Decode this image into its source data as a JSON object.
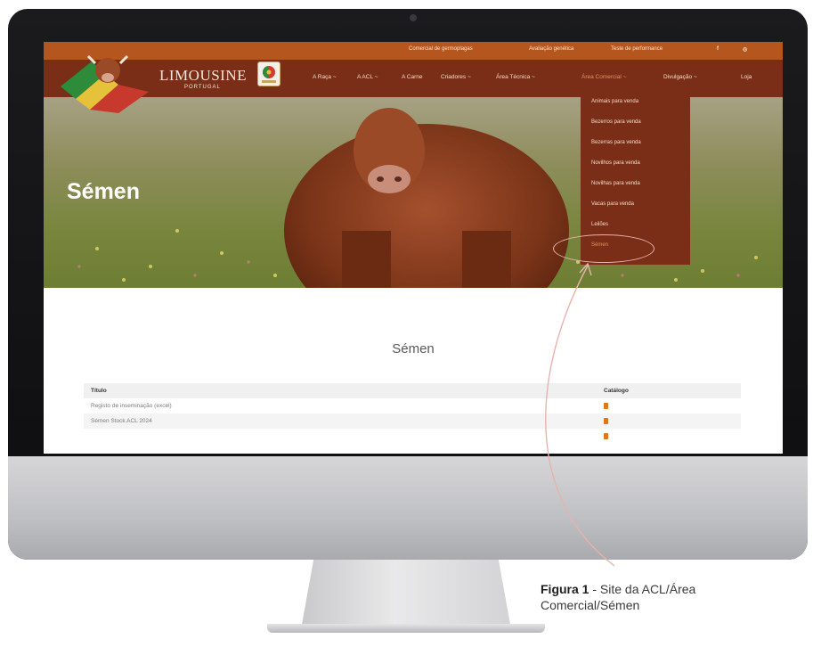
{
  "site": {
    "topbar_links": [
      "Comercial de germoplagas",
      "Avaliação genética",
      "Teste de performance"
    ],
    "logo_text": "LIMOUSINE",
    "logo_sub": "PORTUGAL",
    "nav": [
      "A Raça ~",
      "A ACL ~",
      "A Carne",
      "Criadores ~",
      "Área Técnica ~",
      "Área Comercial ~",
      "Divulgação ~",
      "Loja"
    ],
    "dropdown": [
      "Animais para venda",
      "Bezerros para venda",
      "Bezerras para venda",
      "Novilhos para venda",
      "Novilhas para venda",
      "Vacas para venda",
      "Leilões",
      "Sémen"
    ],
    "hero_title": "Sémen",
    "content_title": "Sémen",
    "table": {
      "headers": [
        "Título",
        "Catálogo"
      ],
      "rows": [
        "Registo de inseminação (excel)",
        "Sémen Stock ACL 2024"
      ]
    }
  },
  "caption": {
    "bold": "Figura 1",
    "text": " - Site da ACL/Área Comercial/Sémen"
  },
  "colors": {
    "accent": "#7a2e17",
    "topbar": "#b5561f",
    "highlight": "#e6915f",
    "annotation": "#e7b3ae"
  }
}
